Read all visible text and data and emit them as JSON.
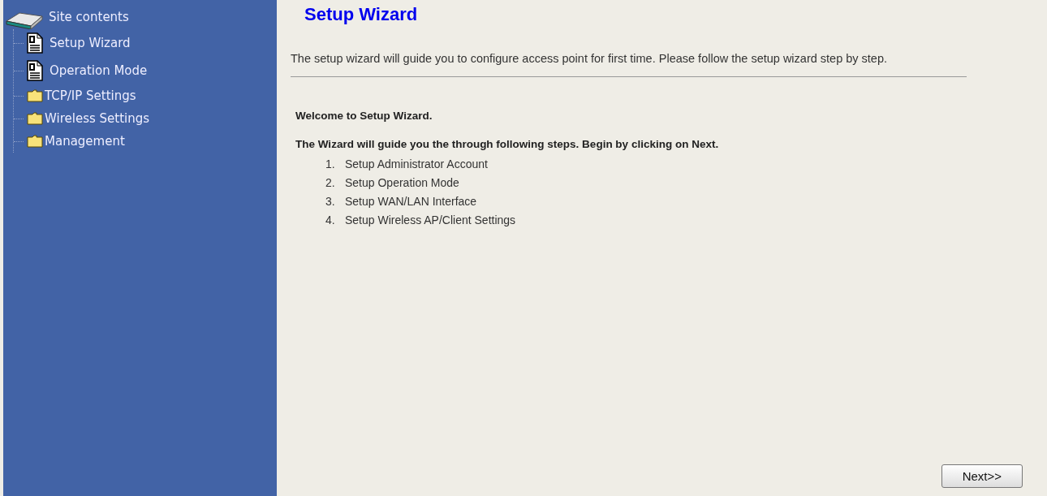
{
  "sidebar": {
    "title": "Site contents",
    "items": [
      {
        "label": "Setup Wizard",
        "kind": "page"
      },
      {
        "label": "Operation Mode",
        "kind": "page"
      },
      {
        "label": "TCP/IP Settings",
        "kind": "folder"
      },
      {
        "label": "Wireless Settings",
        "kind": "folder"
      },
      {
        "label": "Management",
        "kind": "folder"
      }
    ]
  },
  "main": {
    "title": "Setup Wizard",
    "intro": "The setup wizard will guide you to configure access point for first time. Please follow the setup wizard step by step.",
    "welcome": "Welcome to Setup Wizard.",
    "instructions": "The Wizard will guide you the through following steps. Begin by clicking on Next.",
    "steps": [
      {
        "number": "1.",
        "text": "Setup Administrator Account"
      },
      {
        "number": "2.",
        "text": "Setup Operation Mode"
      },
      {
        "number": "3.",
        "text": "Setup WAN/LAN Interface"
      },
      {
        "number": "4.",
        "text": "Setup Wireless AP/Client Settings"
      }
    ],
    "next_button": "Next>>"
  }
}
